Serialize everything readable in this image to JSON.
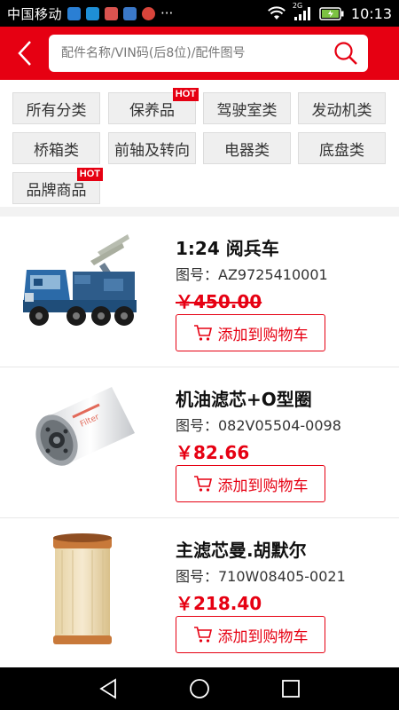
{
  "status": {
    "carrier": "中国移动",
    "network": "2G",
    "time": "10:13",
    "dots": "···"
  },
  "header": {
    "search_placeholder": "配件名称/VIN码(后8位)/配件图号"
  },
  "categories": [
    {
      "label": "所有分类",
      "hot": ""
    },
    {
      "label": "保养品",
      "hot": "HOT"
    },
    {
      "label": "驾驶室类",
      "hot": ""
    },
    {
      "label": "发动机类",
      "hot": ""
    },
    {
      "label": "桥箱类",
      "hot": ""
    },
    {
      "label": "前轴及转向",
      "hot": ""
    },
    {
      "label": "电器类",
      "hot": ""
    },
    {
      "label": "底盘类",
      "hot": ""
    },
    {
      "label": "品牌商品",
      "hot": "HOT"
    }
  ],
  "products": [
    {
      "name": "1:24 阅兵车",
      "code": "图号：AZ9725410001",
      "price": "￥450.00",
      "add_label": "添加到购物车"
    },
    {
      "name": "机油滤芯+O型圈",
      "code": "图号：082V05504-0098",
      "price": "￥82.66",
      "add_label": "添加到购物车"
    },
    {
      "name": "主滤芯曼.胡默尔",
      "code": "图号：710W08405-0021",
      "price": "￥218.40",
      "add_label": "添加到购物车"
    }
  ],
  "colors": {
    "brand": "#e60012",
    "tag_bg": "#efefef"
  }
}
